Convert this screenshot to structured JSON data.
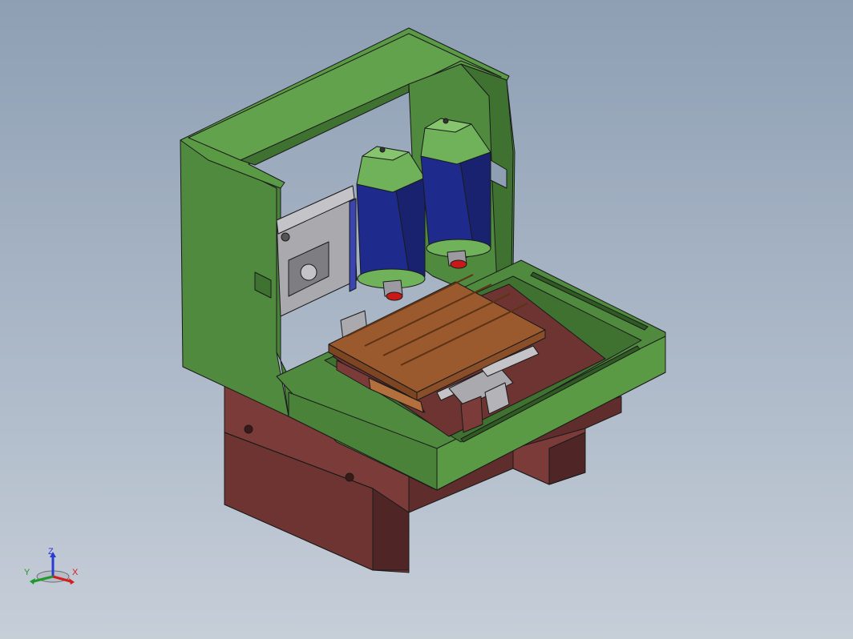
{
  "scene": {
    "colors": {
      "background_top": "#8e9fb4",
      "background_bottom": "#c6ced8",
      "frame_green": "#4f8a3e",
      "frame_green_light": "#63a24c",
      "frame_green_dark": "#3f7230",
      "base_maroon": "#7a3b39",
      "base_maroon_dark": "#4f2625",
      "spindle_blue": "#1e2a8c",
      "spindle_cap_green": "#6fb25a",
      "table_wood": "#9a5a2e",
      "table_wood_light": "#b4703c",
      "rail_gray": "#a9a9ae",
      "accent_red": "#c81818"
    }
  },
  "triad": {
    "x_label": "X",
    "y_label": "Y",
    "z_label": "Z",
    "x_color": "#d21e1e",
    "y_color": "#1e9a2a",
    "z_color": "#2a3ad2"
  }
}
